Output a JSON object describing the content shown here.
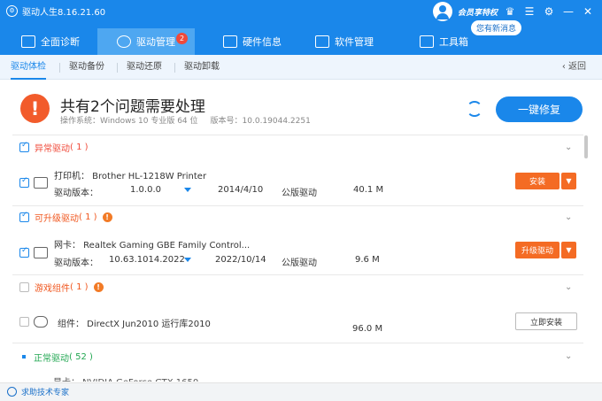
{
  "app": {
    "title": "驱动人生8.16.21.60",
    "member_label": "会员享特权",
    "message_pill": "您有新消息"
  },
  "nav": {
    "tabs": [
      {
        "label": "全面诊断"
      },
      {
        "label": "驱动管理",
        "badge": "2"
      },
      {
        "label": "硬件信息"
      },
      {
        "label": "软件管理"
      },
      {
        "label": "工具箱"
      }
    ]
  },
  "subnav": {
    "items": [
      "驱动体检",
      "驱动备份",
      "驱动还原",
      "驱动卸载"
    ],
    "back": "返回"
  },
  "summary": {
    "headline": "共有2个问题需要处理",
    "os_label": "操作系统：Windows 10 专业版 64 位",
    "build_label": "版本号：10.0.19044.2251",
    "fix_button": "一键修复"
  },
  "sections": [
    {
      "title": "异常驱动",
      "count": "( 1 )",
      "item": {
        "name": "打印机：  Brother HL-1218W Printer",
        "version_label": "驱动版本：",
        "version": "1.0.0.0",
        "date": "2014/4/10",
        "type": "公版驱动",
        "size": "40.1 M",
        "action": "安装"
      }
    },
    {
      "title": "可升级驱动",
      "count": "( 1 )",
      "item": {
        "name": "网卡：  Realtek Gaming GBE Family Control...",
        "version_label": "驱动版本：",
        "version": "10.63.1014.2022",
        "date": "2022/10/14",
        "type": "公版驱动",
        "size": "9.6 M",
        "action": "升级驱动"
      }
    },
    {
      "title": "游戏组件",
      "count": "( 1 )",
      "item": {
        "name": "组件：  DirectX Jun2010 运行库2010",
        "size": "96.0 M",
        "action": "立即安装"
      }
    },
    {
      "title": "正常驱动",
      "count": "( 52 )"
    }
  ],
  "partial_row": "显卡：  NVIDIA GeForce GTX 1650",
  "footer": {
    "help": "求助技术专家"
  },
  "colors": {
    "primary": "#1a87ea",
    "warning": "#f25b2b",
    "action": "#f46b24",
    "normal": "#22a752"
  }
}
